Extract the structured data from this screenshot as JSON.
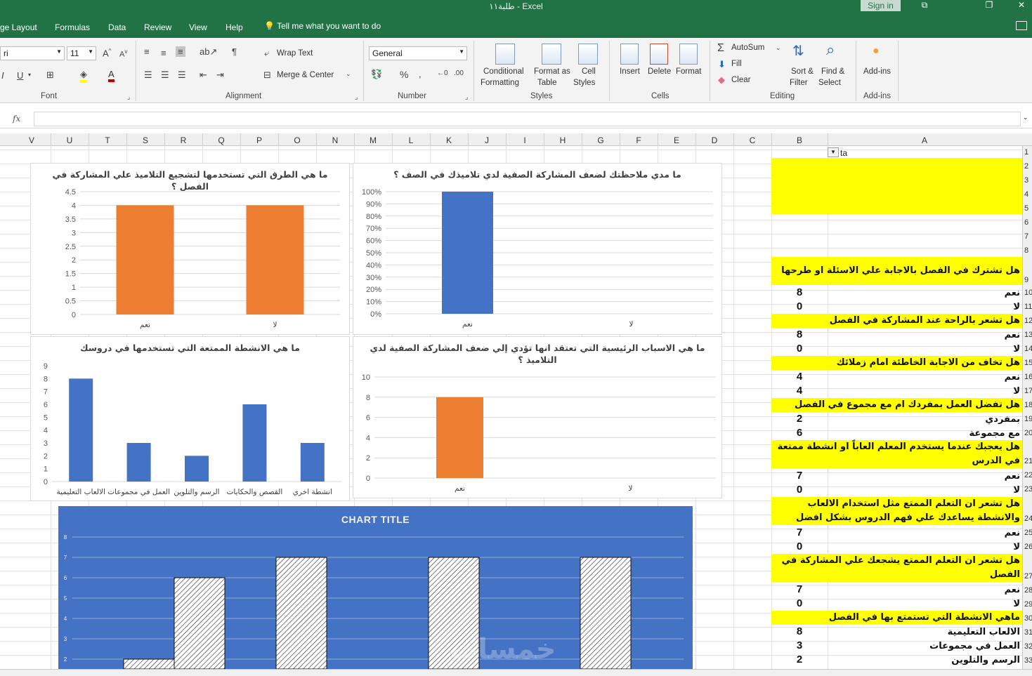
{
  "window": {
    "title": "طلبة١١  -  Excel",
    "sign_in": "Sign in"
  },
  "tabs": [
    "ge Layout",
    "Formulas",
    "Data",
    "Review",
    "View",
    "Help"
  ],
  "tell_me": "Tell me what you want to do",
  "ribbon": {
    "font_name": "ri",
    "font_size": "11",
    "wrap_text": "Wrap Text",
    "merge_center": "Merge & Center",
    "number_format": "General",
    "conditional_formatting": [
      "Conditional",
      "Formatting"
    ],
    "format_as_table": [
      "Format as",
      "Table"
    ],
    "cell_styles": [
      "Cell",
      "Styles"
    ],
    "insert": "Insert",
    "delete": "Delete",
    "format": "Format",
    "autosum": "AutoSum",
    "fill": "Fill",
    "clear": "Clear",
    "sort_filter": [
      "Sort &",
      "Filter"
    ],
    "find_select": [
      "Find &",
      "Select"
    ],
    "add_ins": "Add-ins",
    "groups": {
      "font": "Font",
      "alignment": "Alignment",
      "number": "Number",
      "styles": "Styles",
      "cells": "Cells",
      "editing": "Editing",
      "add_ins": "Add-ins"
    }
  },
  "formula_bar": {
    "fx": "fx",
    "value": ""
  },
  "columns": [
    "V",
    "U",
    "T",
    "S",
    "R",
    "Q",
    "P",
    "O",
    "N",
    "M",
    "L",
    "K",
    "J",
    "I",
    "H",
    "G",
    "F",
    "E",
    "D",
    "C",
    "B",
    "A"
  ],
  "row_numbers": [
    "1",
    "2",
    "3",
    "4",
    "5",
    "6",
    "7",
    "8",
    "9",
    "10",
    "11",
    "12",
    "13",
    "14",
    "15",
    "16",
    "17",
    "18",
    "19",
    "20",
    "21",
    "22",
    "23",
    "24",
    "25",
    "26",
    "27",
    "28",
    "29",
    "30",
    "31",
    "32",
    "33"
  ],
  "cell_a1": "ta",
  "sheet": {
    "questions": [
      "هل تشترك في الفصل بالاجابة علي الاسئلة او طرحها",
      "هل تشعر بالراحة عند المشاركة في الفصل",
      "هل تخاف من الاجابة الخاطئة امام زملائك",
      "هل تفضل العمل بمفردك ام مع مجموع في الفصل",
      "هل يعجبك عندما يستخدم المعلم العاباً او انشطة ممتعة في الدرس",
      "هل تشعر ان التعلم الممتع مثل استخدام الالعاب والانشطة يساعدك علي فهم الدروس بشكل افضل",
      "هل تشعر ان التعلم الممتع يشجعك علي المشاركة في الفصل",
      "ماهي الانشطة التي تستمتع بها في الفصل"
    ],
    "answers": [
      {
        "label": "نعم",
        "value": "8"
      },
      {
        "label": "لا",
        "value": "0"
      },
      {
        "label": "نعم",
        "value": "8"
      },
      {
        "label": "لا",
        "value": "0"
      },
      {
        "label": "نعم",
        "value": "4"
      },
      {
        "label": "لا",
        "value": "4"
      },
      {
        "label": "بمفردي",
        "value": "2"
      },
      {
        "label": "مع مجموعة",
        "value": "6"
      },
      {
        "label": "نعم",
        "value": "7"
      },
      {
        "label": "لا",
        "value": "0"
      },
      {
        "label": "نعم",
        "value": "7"
      },
      {
        "label": "لا",
        "value": "0"
      },
      {
        "label": "نعم",
        "value": "7"
      },
      {
        "label": "لا",
        "value": "0"
      },
      {
        "label": "الالعاب التعليمية",
        "value": "8"
      },
      {
        "label": "العمل في مجموعات",
        "value": "3"
      },
      {
        "label": "الرسم والتلوين",
        "value": "2"
      }
    ]
  },
  "watermark": "خمسات",
  "chart_data": [
    {
      "type": "bar",
      "title": "ما هي الطرق التي تستخدمها لتشجيع التلاميذ علي المشاركة في الفصل ؟",
      "categories": [
        "نعم",
        "لا"
      ],
      "values": [
        4,
        4
      ],
      "ylim": [
        0,
        4.5
      ],
      "yticks": [
        "0",
        "0.5",
        "1",
        "1.5",
        "2",
        "2.5",
        "3",
        "3.5",
        "4",
        "4.5"
      ],
      "color": "#ed7d31",
      "grid": true
    },
    {
      "type": "bar",
      "title": "ما مدي ملاحظتك لضعف المشاركة الصفية  لدي تلاميذك في الصف ؟",
      "categories": [
        "نعم",
        "لا"
      ],
      "values": [
        100,
        0
      ],
      "ylim": [
        0,
        100
      ],
      "yticks": [
        "0%",
        "10%",
        "20%",
        "30%",
        "40%",
        "50%",
        "60%",
        "70%",
        "80%",
        "90%",
        "100%"
      ],
      "color": "#4472c4",
      "grid": true
    },
    {
      "type": "bar",
      "title": "ما هي الانشطة الممتعة التي تستخدمها في دروسك",
      "categories": [
        "الالعاب التعليمية",
        "العمل في مجموعات",
        "الرسم والتلوين",
        "القصص والحكايات",
        "انشطة اخري"
      ],
      "values": [
        8,
        3,
        2,
        6,
        3
      ],
      "ylim": [
        0,
        9
      ],
      "yticks": [
        "0",
        "1",
        "2",
        "3",
        "4",
        "5",
        "6",
        "7",
        "8",
        "9"
      ],
      "color": "#4472c4",
      "grid": false
    },
    {
      "type": "bar",
      "title": "ما هي الاسباب الرئيسية التي تعتقد انها تؤدي إلي ضعف المشاركة الصفية لدي التلاميذ ؟",
      "categories": [
        "نعم",
        "لا"
      ],
      "values": [
        8,
        0
      ],
      "ylim": [
        0,
        10
      ],
      "yticks": [
        "0",
        "2",
        "4",
        "6",
        "8",
        "10"
      ],
      "color": "#ed7d31",
      "grid": true
    },
    {
      "type": "bar",
      "title": "CHART TITLE",
      "series": [
        {
          "values": [
            0,
            2,
            7,
            null,
            7,
            7
          ]
        },
        {
          "values": [
            null,
            6,
            null,
            null,
            null,
            null
          ]
        }
      ],
      "visible_bars": [
        2,
        6,
        7,
        7,
        7
      ],
      "ylim": [
        1.6,
        8
      ],
      "yticks": [
        "2",
        "3",
        "4",
        "5",
        "6",
        "7",
        "8"
      ],
      "color": "#4472c4",
      "pattern": "hatched",
      "grid": true
    }
  ]
}
